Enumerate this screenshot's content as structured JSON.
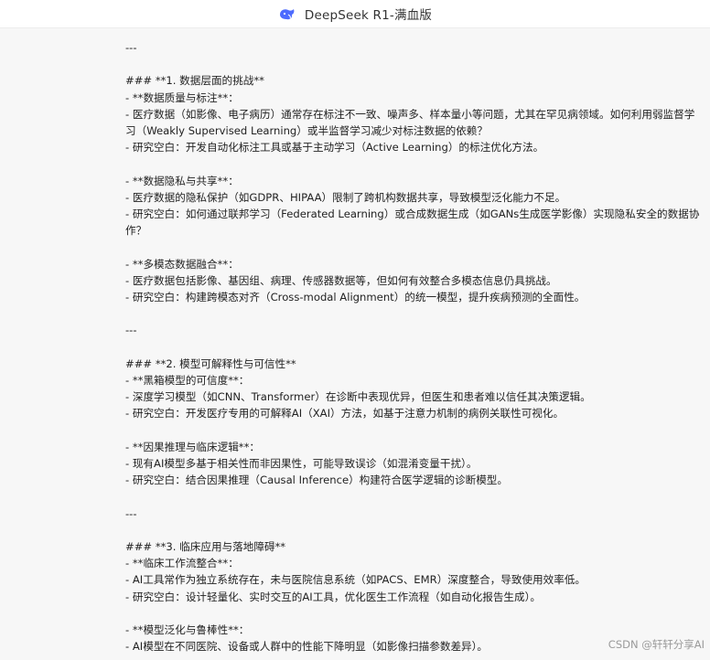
{
  "window": {
    "title": "DeepSeek R1-满血版",
    "logo_icon": "deepseek-whale-icon"
  },
  "document": {
    "lines": [
      "---",
      "",
      "### **1. 数据层面的挑战**",
      "- **数据质量与标注**：",
      "  - 医疗数据（如影像、电子病历）通常存在标注不一致、噪声多、样本量小等问题，尤其在罕见病领域。如何利用弱监督学习（Weakly Supervised Learning）或半监督学习减少对标注数据的依赖？",
      "  - 研究空白：开发自动化标注工具或基于主动学习（Active Learning）的标注优化方法。",
      "",
      "- **数据隐私与共享**：",
      "  - 医疗数据的隐私保护（如GDPR、HIPAA）限制了跨机构数据共享，导致模型泛化能力不足。",
      "  - 研究空白：如何通过联邦学习（Federated Learning）或合成数据生成（如GANs生成医学影像）实现隐私安全的数据协作？",
      "",
      "- **多模态数据融合**：",
      "  - 医疗数据包括影像、基因组、病理、传感器数据等，但如何有效整合多模态信息仍具挑战。",
      "  - 研究空白：构建跨模态对齐（Cross-modal Alignment）的统一模型，提升疾病预测的全面性。",
      "",
      "---",
      "",
      "### **2. 模型可解释性与可信性**",
      "- **黑箱模型的可信度**：",
      "  - 深度学习模型（如CNN、Transformer）在诊断中表现优异，但医生和患者难以信任其决策逻辑。",
      "  - 研究空白：开发医疗专用的可解释AI（XAI）方法，如基于注意力机制的病例关联性可视化。",
      "",
      "- **因果推理与临床逻辑**：",
      "  - 现有AI模型多基于相关性而非因果性，可能导致误诊（如混淆变量干扰）。",
      "  - 研究空白：结合因果推理（Causal Inference）构建符合医学逻辑的诊断模型。",
      "",
      "---",
      "",
      "### **3. 临床应用与落地障碍**",
      "- **临床工作流整合**：",
      "  - AI工具常作为独立系统存在，未与医院信息系统（如PACS、EMR）深度整合，导致使用效率低。",
      "  - 研究空白：设计轻量化、实时交互的AI工具，优化医生工作流程（如自动化报告生成）。",
      "",
      "- **模型泛化与鲁棒性**：",
      "  - AI模型在不同医院、设备或人群中的性能下降明显（如影像扫描参数差异）。"
    ]
  },
  "watermark": "CSDN @轩轩分享AI"
}
